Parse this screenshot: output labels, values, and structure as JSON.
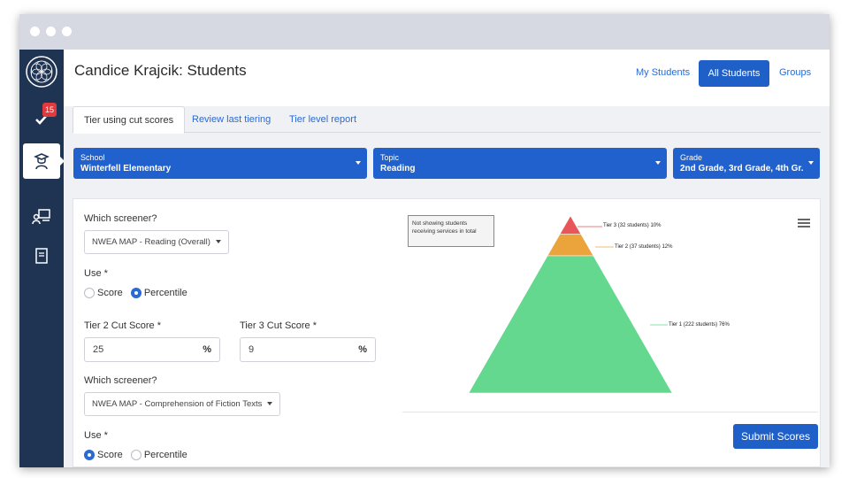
{
  "app": {
    "title": "Candice Krajcik: Students",
    "notification_count": "15"
  },
  "nav": {
    "my_students": "My Students",
    "all_students": "All Students",
    "groups": "Groups"
  },
  "tabs": [
    {
      "label": "Tier using cut scores",
      "active": true
    },
    {
      "label": "Review last tiering",
      "active": false
    },
    {
      "label": "Tier level report",
      "active": false
    }
  ],
  "filters": {
    "school": {
      "label": "School",
      "value": "Winterfell Elementary"
    },
    "topic": {
      "label": "Topic",
      "value": "Reading"
    },
    "grade": {
      "label": "Grade",
      "value": "2nd Grade, 3rd Grade, 4th Gr.."
    }
  },
  "form": {
    "screener1": {
      "label": "Which screener?",
      "value": "NWEA MAP - Reading (Overall)",
      "use_label": "Use *",
      "options": [
        "Score",
        "Percentile"
      ],
      "selected": "Percentile"
    },
    "cut_scores": {
      "tier2_label": "Tier 2 Cut Score *",
      "tier2_value": "25",
      "tier3_label": "Tier 3 Cut Score *",
      "tier3_value": "9",
      "unit": "%"
    },
    "screener2": {
      "label": "Which screener?",
      "value": "NWEA MAP - Comprehension of Fiction Texts",
      "use_label": "Use *",
      "options": [
        "Score",
        "Percentile"
      ],
      "selected": "Score"
    }
  },
  "chart_data": {
    "type": "pyramid",
    "note": "Not showing students receiving services in total",
    "series": [
      {
        "name": "Tier 3",
        "students": 32,
        "percent": 10,
        "label": "Tier 3 (32 students) 10%",
        "color": "#e9565a"
      },
      {
        "name": "Tier 2",
        "students": 37,
        "percent": 12,
        "label": "Tier 2 (37 students) 12%",
        "color": "#eba43c"
      },
      {
        "name": "Tier 1",
        "students": 222,
        "percent": 76,
        "label": "Tier 1 (222 students) 76%",
        "color": "#63d88e"
      }
    ]
  },
  "actions": {
    "submit": "Submit Scores"
  },
  "colors": {
    "sidebar": "#1f3353",
    "primary": "#1f5fc8",
    "link": "#2a6ad2"
  }
}
